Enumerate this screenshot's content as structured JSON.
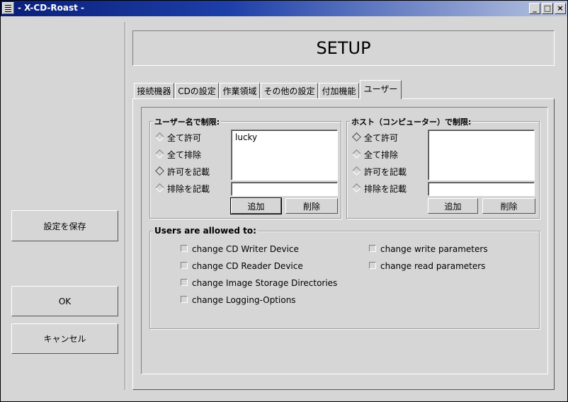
{
  "window": {
    "title": "- X-CD-Roast -",
    "minimize": "_",
    "maximize": "□",
    "close": "×"
  },
  "sidebar": {
    "save_label": "設定を保存",
    "ok_label": "OK",
    "cancel_label": "キャンセル"
  },
  "header": {
    "title": "SETUP"
  },
  "tabs": [
    "接続機器",
    "CDの設定",
    "作業領域",
    "その他の設定",
    "付加機能",
    "ユーザー"
  ],
  "active_tab": 5,
  "users_group": {
    "label": "ユーザー名で制限:",
    "radios": [
      "全て許可",
      "全て排除",
      "許可を記載",
      "排除を記載"
    ],
    "selected": 2,
    "list": [
      "lucky"
    ],
    "entry_value": "",
    "add_label": "追加",
    "remove_label": "削除"
  },
  "hosts_group": {
    "label": "ホスト（コンピューター）で制限:",
    "radios": [
      "全て許可",
      "全て排除",
      "許可を記載",
      "排除を記載"
    ],
    "selected": 0,
    "list": [],
    "entry_value": "",
    "add_label": "追加",
    "remove_label": "削除"
  },
  "permissions": {
    "label": "Users are allowed to:",
    "items": [
      "change CD Writer Device",
      "change CD Reader Device",
      "change Image Storage Directories",
      "change Logging-Options",
      "change write parameters",
      "change read parameters"
    ]
  }
}
